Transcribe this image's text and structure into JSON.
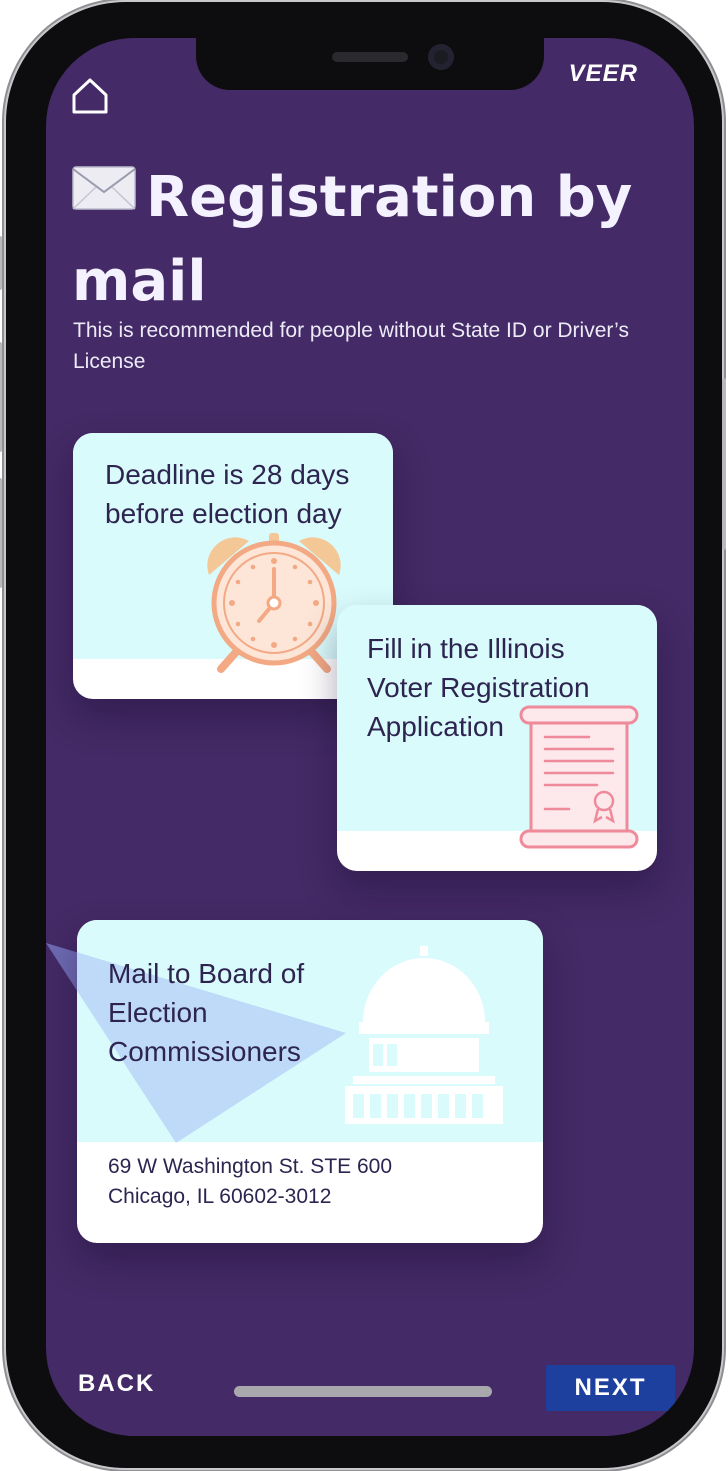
{
  "app": {
    "brand": "VEER"
  },
  "header": {
    "title": "Registration by mail",
    "subtitle": "This is recommended for people without State ID or Driver’s License"
  },
  "cards": [
    {
      "text": "Deadline is 28 days before election day",
      "icon": "alarm-clock-icon"
    },
    {
      "text": "Fill in the Illinois Voter Registration Application",
      "icon": "scroll-document-icon"
    },
    {
      "text": "Mail to Board of Election Commissioners",
      "icon": "capitol-building-icon",
      "address_line1": "69 W Washington St. STE 600",
      "address_line2": "Chicago, IL 60602-3012"
    }
  ],
  "nav": {
    "back_label": "BACK",
    "next_label": "NEXT"
  },
  "colors": {
    "background": "#442a66",
    "card_top": "#d9fbfc",
    "next_button": "#1d3f9e"
  }
}
